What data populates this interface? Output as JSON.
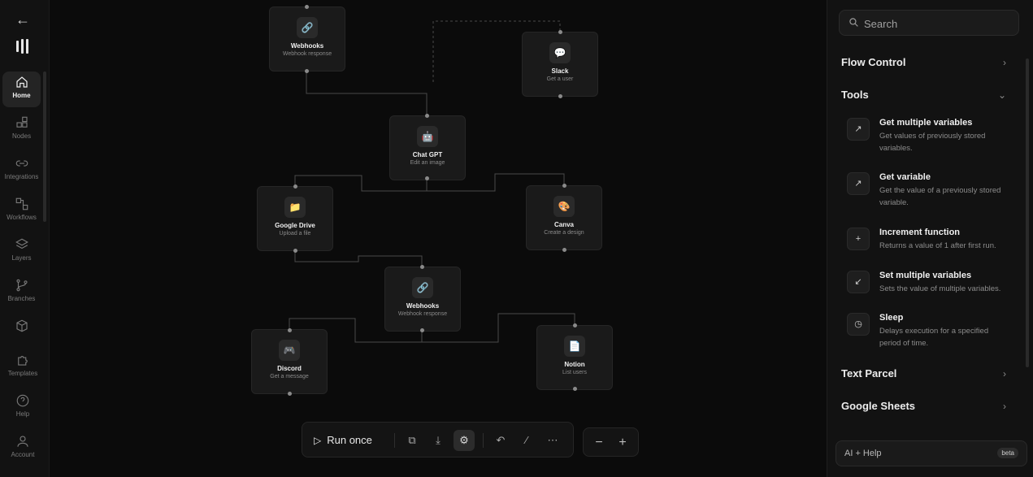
{
  "sidebar": {
    "back_icon": "arrow-left-icon",
    "logo_icon": "bars-logo-icon",
    "items": [
      {
        "label": "Home",
        "icon": "home-icon",
        "active": true
      },
      {
        "label": "Nodes",
        "icon": "grid-icon"
      },
      {
        "label": "Integrations",
        "icon": "link-icon"
      },
      {
        "label": "Workflows",
        "icon": "workflow-icon"
      },
      {
        "label": "Layers",
        "icon": "layers-icon"
      },
      {
        "label": "Branches",
        "icon": "branch-icon"
      },
      {
        "label": "",
        "icon": "cube-icon"
      }
    ],
    "bottom": [
      {
        "label": "Templates",
        "icon": "puzzle-icon"
      },
      {
        "label": "Help",
        "icon": "help-icon"
      },
      {
        "label": "Account",
        "icon": "user-icon"
      }
    ]
  },
  "nodes": [
    {
      "id": "webhooks-1",
      "title": "Webhooks",
      "subtitle": "Webhook response",
      "icon": "link-icon"
    },
    {
      "id": "slack",
      "title": "Slack",
      "subtitle": "Get a user",
      "icon": "slack-icon"
    },
    {
      "id": "chatgpt",
      "title": "Chat GPT",
      "subtitle": "Edit an image",
      "icon": "robot-icon"
    },
    {
      "id": "gdrive",
      "title": "Google Drive",
      "subtitle": "Upload a file",
      "icon": "folder-icon"
    },
    {
      "id": "canva",
      "title": "Canva",
      "subtitle": "Create a design",
      "icon": "palette-icon"
    },
    {
      "id": "webhooks-2",
      "title": "Webhooks",
      "subtitle": "Webhook response",
      "icon": "link-icon"
    },
    {
      "id": "discord",
      "title": "Discord",
      "subtitle": "Get a message",
      "icon": "gamepad-icon"
    },
    {
      "id": "notion",
      "title": "Notion",
      "subtitle": "List users",
      "icon": "notion-icon"
    }
  ],
  "toolbar": {
    "run_label": "Run once",
    "buttons": [
      "copy-icon",
      "download-icon",
      "settings-icon",
      "undo-icon",
      "magic-wand-icon",
      "more-icon"
    ],
    "zoom_out": "−",
    "zoom_in": "+"
  },
  "panel": {
    "search_placeholder": "Search",
    "sections": {
      "flow_control": "Flow Control",
      "tools": "Tools",
      "text_parcel": "Text Parcel",
      "google_sheets": "Google Sheets"
    },
    "tools": [
      {
        "title": "Get multiple variables",
        "desc": "Get values of previously stored variables.",
        "icon": "arrow-up-right-icon"
      },
      {
        "title": "Get variable",
        "desc": "Get the value of a previously stored variable.",
        "icon": "arrow-up-right-icon"
      },
      {
        "title": "Increment function",
        "desc": "Returns a value of 1 after first run.",
        "icon": "plus-icon"
      },
      {
        "title": "Set multiple variables",
        "desc": "Sets the value of multiple variables.",
        "icon": "arrow-down-left-icon"
      },
      {
        "title": "Sleep",
        "desc": "Delays execution for a specified period of time.",
        "icon": "clock-icon"
      }
    ],
    "ai_help_label": "AI + Help",
    "beta_label": "beta"
  }
}
